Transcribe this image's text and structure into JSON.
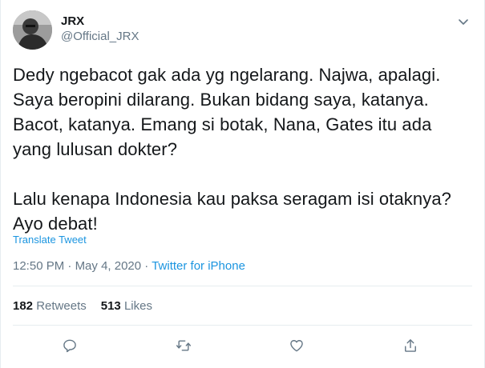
{
  "user": {
    "display_name": "JRX",
    "handle": "@Official_JRX"
  },
  "tweet": {
    "paragraphs": [
      "Dedy ngebacot gak ada yg ngelarang. Najwa, apalagi. Saya beropini dilarang. Bukan bidang saya, katanya. Bacot, katanya. Emang si botak, Nana, Gates itu ada yang lulusan dokter?",
      "Lalu kenapa Indonesia kau paksa seragam isi otaknya? Ayo debat!"
    ],
    "translate_label": "Translate Tweet",
    "time": "12:50 PM",
    "date": "May 4, 2020",
    "separator": " · ",
    "source": "Twitter for iPhone"
  },
  "stats": {
    "retweets_count": "182",
    "retweets_label": "Retweets",
    "likes_count": "513",
    "likes_label": "Likes"
  },
  "icons": {
    "caret": "chevron-down-icon",
    "reply": "reply-icon",
    "retweet": "retweet-icon",
    "like": "heart-icon",
    "share": "share-icon"
  },
  "colors": {
    "accent": "#1b95e0",
    "muted": "#657786",
    "text": "#14171a",
    "border": "#e6ecf0"
  }
}
